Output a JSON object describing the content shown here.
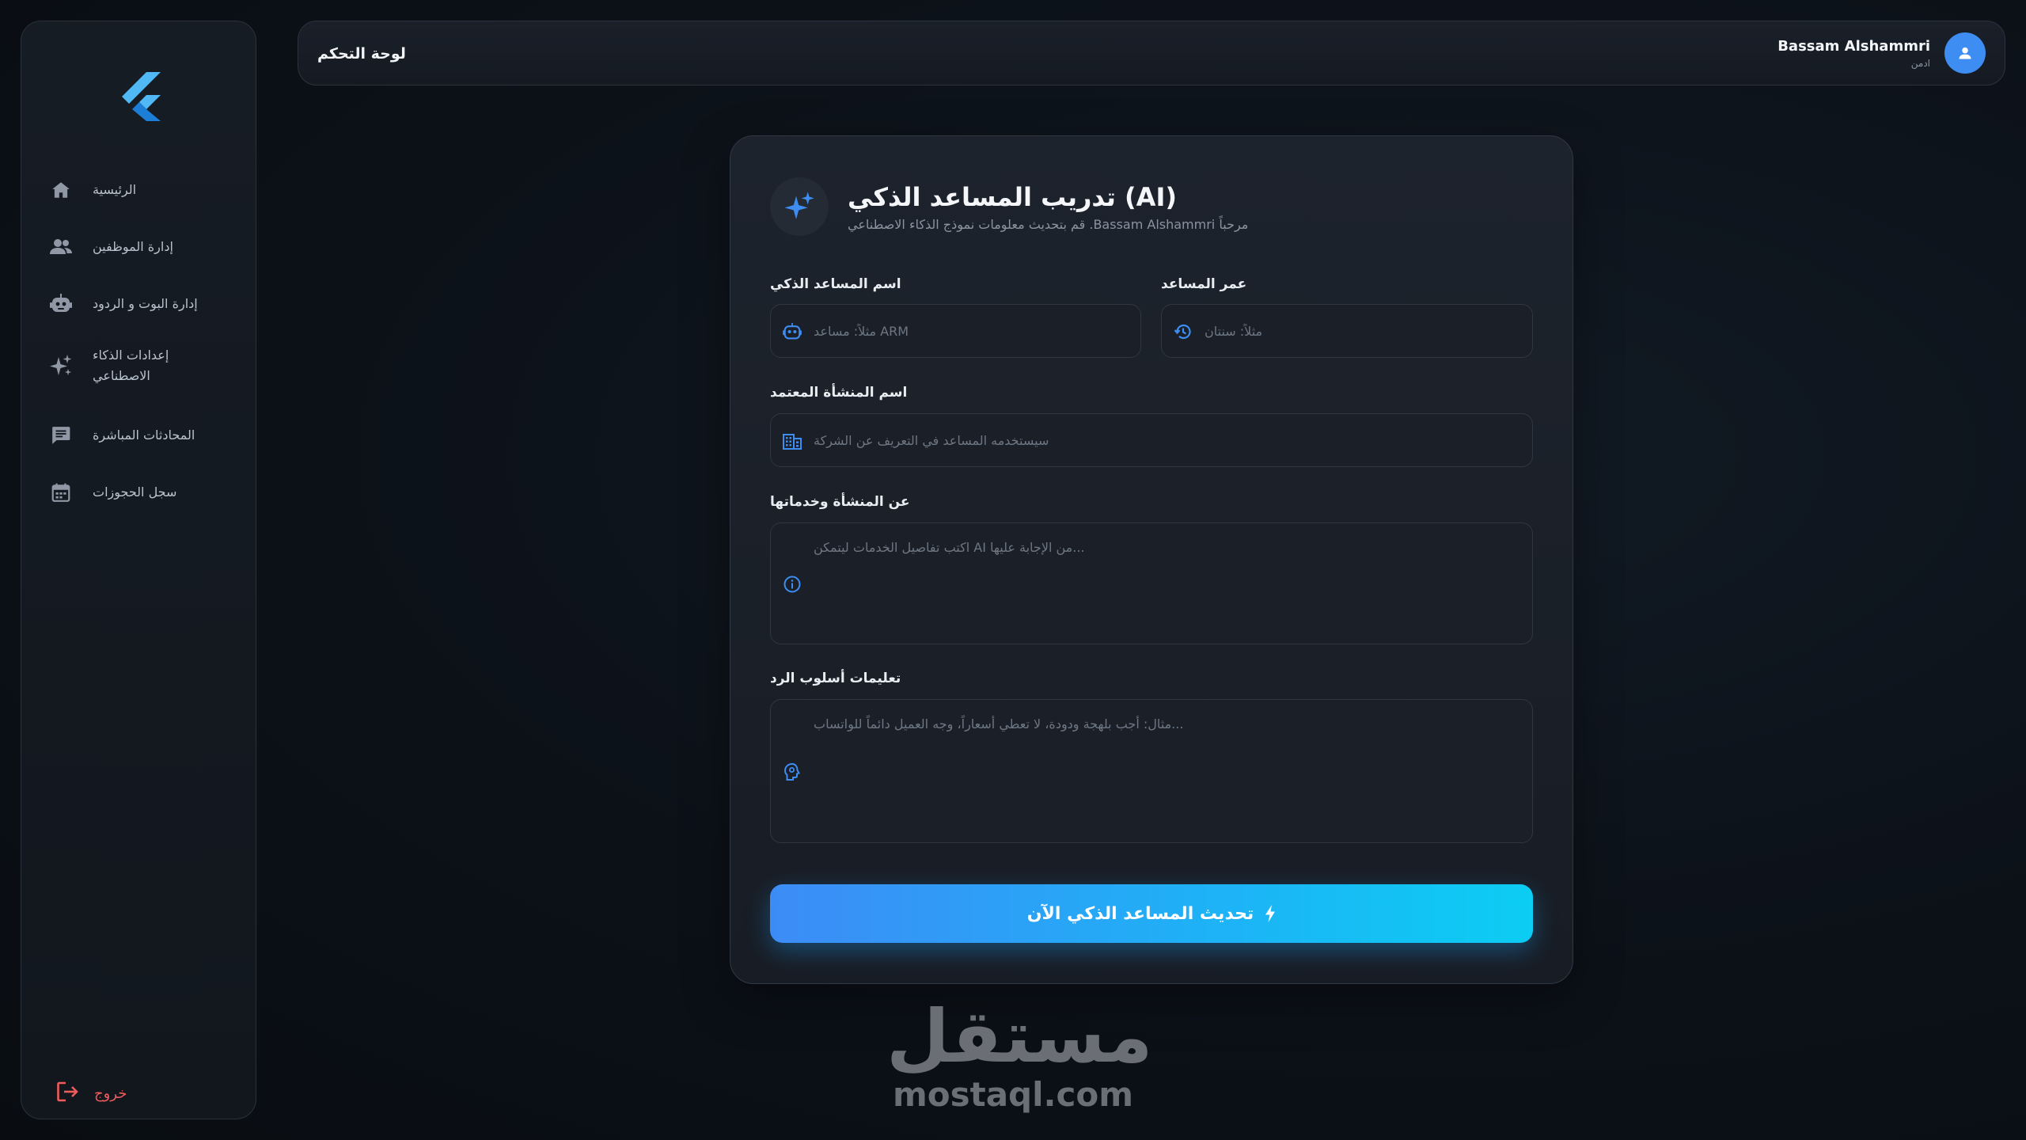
{
  "sidebar": {
    "logo_icon": "flutter-logo",
    "items": [
      {
        "label": "الرئيسية",
        "icon": "home-icon"
      },
      {
        "label": "إدارة الموظفين",
        "icon": "users-icon"
      },
      {
        "label": "إدارة البوت و الردود",
        "icon": "robot-icon"
      },
      {
        "label": "إعدادات الذكاء الاصطناعي",
        "icon": "sparkle-icon"
      },
      {
        "label": "المحادثات المباشرة",
        "icon": "chat-icon"
      },
      {
        "label": "سجل الحجوزات",
        "icon": "calendar-icon"
      }
    ],
    "logout_label": "خروج"
  },
  "header": {
    "title": "لوحة التحكم",
    "user_name": "Bassam Alshammri",
    "user_role": "ادمن"
  },
  "card": {
    "title": "تدريب المساعد الذكي (AI)",
    "subtitle": "قم بتحديث معلومات نموذج الذكاء الاصطناعي .Bassam Alshammri مرحباً",
    "fields": {
      "assistant_name": {
        "label": "اسم المساعد الذكي",
        "placeholder": "مثلاً: مساعد ARM",
        "value": ""
      },
      "assistant_age": {
        "label": "عمر المساعد",
        "placeholder": "مثلاً: سنتان",
        "value": ""
      },
      "org_name": {
        "label": "اسم المنشأة المعتمد",
        "placeholder": "سيستخدمه المساعد في التعريف عن الشركة",
        "value": ""
      },
      "about_org": {
        "label": "عن المنشأة وخدماتها",
        "placeholder": "اكتب تفاصيل الخدمات ليتمكن AI من الإجابة عليها...",
        "value": ""
      },
      "reply_style": {
        "label": "تعليمات أسلوب الرد",
        "placeholder": "مثال: أجب بلهجة ودودة، لا تعطي أسعاراً، وجه العميل دائماً للواتساب...",
        "value": ""
      }
    },
    "submit_label": "تحديث المساعد الذكي الآن"
  },
  "watermark": {
    "arabic": "مستقل",
    "latin": "mostaql.com"
  },
  "colors": {
    "accent": "#3d8df3",
    "accent_cyan": "#0ccdf3",
    "danger": "#ef5b5b",
    "background": "#0c1118"
  }
}
